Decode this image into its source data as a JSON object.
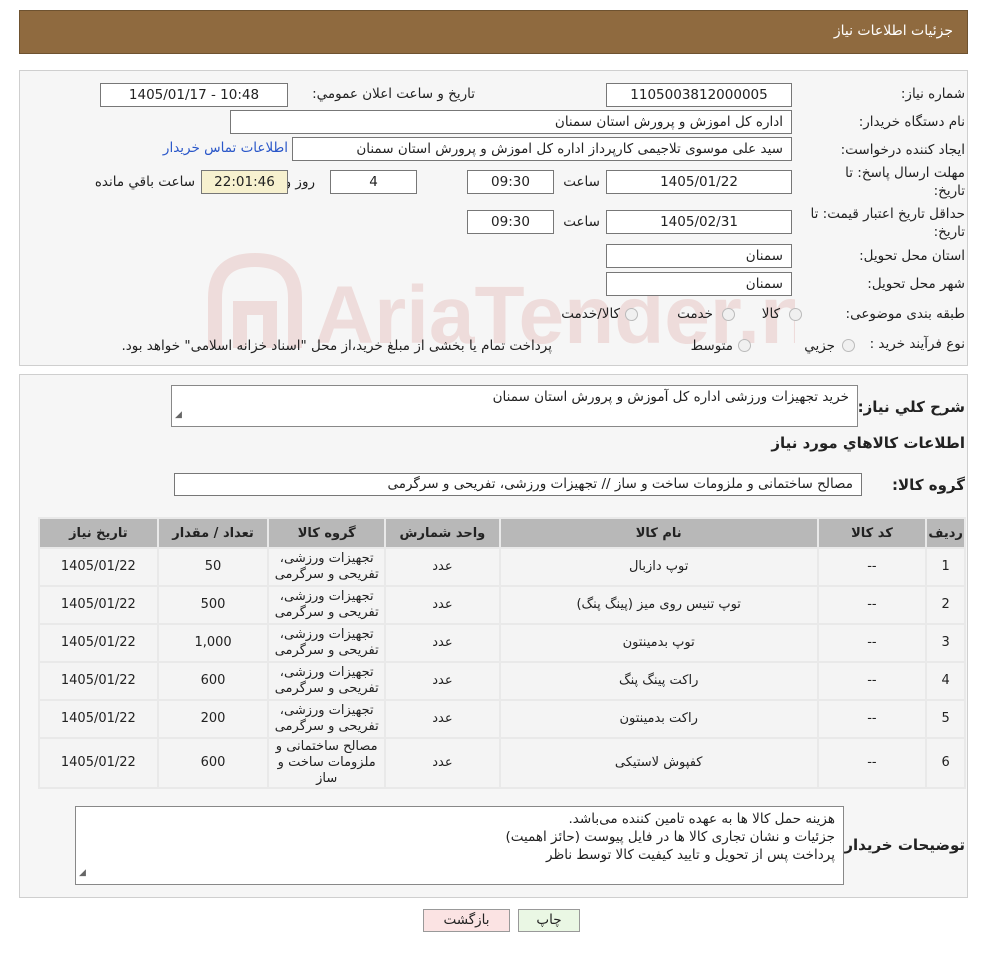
{
  "header": {
    "title": "جزئیات اطلاعات نیاز"
  },
  "watermark": {
    "text": "AriaTender.neT",
    "color": "#c0392b"
  },
  "form": {
    "need_number_label": "شماره نیاز:",
    "need_number": "1105003812000005",
    "announce_label": "تاريخ و ساعت اعلان عمومي:",
    "announce_value": "1405/01/17 - 10:48",
    "buyer_org_label": "نام دستگاه خريدار:",
    "buyer_org": "اداره کل اموزش و پرورش استان سمنان",
    "creator_label": "ايجاد کننده درخواست:",
    "creator": "سید علی موسوی تلاجیمی کارپرداز اداره کل اموزش و پرورش استان سمنان",
    "contact_link": "اطلاعات تماس خريدار",
    "deadline_label_1": "مهلت ارسال پاسخ: تا",
    "deadline_label_2": "تاريخ:",
    "deadline_date": "1405/01/22",
    "time_label": "ساعت",
    "deadline_time": "09:30",
    "days_value": "4",
    "days_label": "روز و",
    "remaining_time": "22:01:46",
    "remaining_label": "ساعت باقي مانده",
    "validity_label_1": "حداقل تاريخ اعتبار قيمت: تا",
    "validity_label_2": "تاريخ:",
    "validity_date": "1405/02/31",
    "validity_time": "09:30",
    "province_label": "استان محل تحويل:",
    "province": "سمنان",
    "city_label": "شهر محل تحويل:",
    "city": "سمنان",
    "category_label": "طبقه بندی موضوعی:",
    "category_options": [
      "کالا",
      "خدمت",
      "کالا/خدمت"
    ],
    "process_label": "نوع فرآيند خريد :",
    "process_options": [
      "جزيي",
      "متوسط"
    ],
    "process_note": "پرداخت تمام يا بخشی از مبلغ خريد،از محل \"اسناد خزانه اسلامی\" خواهد بود."
  },
  "details": {
    "summary_label": "شرح کلي نياز:",
    "summary": "خرید تجهیزات ورزشی اداره کل آموزش و پرورش استان سمنان",
    "goods_info_label": "اطلاعات کالاهاي مورد نياز",
    "group_label": "گروه کالا:",
    "group_value": "مصالح ساختمانی و ملزومات ساخت و ساز // تجهیزات ورزشی، تفریحی و سرگرمی"
  },
  "table": {
    "headers": [
      "رديف",
      "کد کالا",
      "نام کالا",
      "واحد شمارش",
      "گروه کالا",
      "تعداد / مقدار",
      "تاريخ نياز"
    ],
    "rows": [
      [
        "1",
        "--",
        "توپ دازبال",
        "عدد",
        "تجهیزات ورزشی، تفریحی و سرگرمی",
        "50",
        "1405/01/22"
      ],
      [
        "2",
        "--",
        "توپ تنیس روی میز (پینگ پنگ)",
        "عدد",
        "تجهیزات ورزشی، تفریحی و سرگرمی",
        "500",
        "1405/01/22"
      ],
      [
        "3",
        "--",
        "توپ بدمینتون",
        "عدد",
        "تجهیزات ورزشی، تفریحی و سرگرمی",
        "1,000",
        "1405/01/22"
      ],
      [
        "4",
        "--",
        "راکت پینگ پنگ",
        "عدد",
        "تجهیزات ورزشی، تفریحی و سرگرمی",
        "600",
        "1405/01/22"
      ],
      [
        "5",
        "--",
        "راکت بدمینتون",
        "عدد",
        "تجهیزات ورزشی، تفریحی و سرگرمی",
        "200",
        "1405/01/22"
      ],
      [
        "6",
        "--",
        "کفپوش لاستیکی",
        "عدد",
        "مصالح ساختمانی و ملزومات ساخت و ساز",
        "600",
        "1405/01/22"
      ]
    ]
  },
  "buyer_notes": {
    "label": "توضيحات خريدار:",
    "lines": [
      "هزینه حمل کالا ها به عهده تامین کننده می‌باشد.",
      "جزئیات و نشان تجاری کالا ها در فایل پیوست (حائز اهمیت)",
      "پرداخت پس از تحویل و تایید کیفیت کالا توسط ناظر"
    ]
  },
  "buttons": {
    "print": "چاپ",
    "back": "بازگشت"
  }
}
